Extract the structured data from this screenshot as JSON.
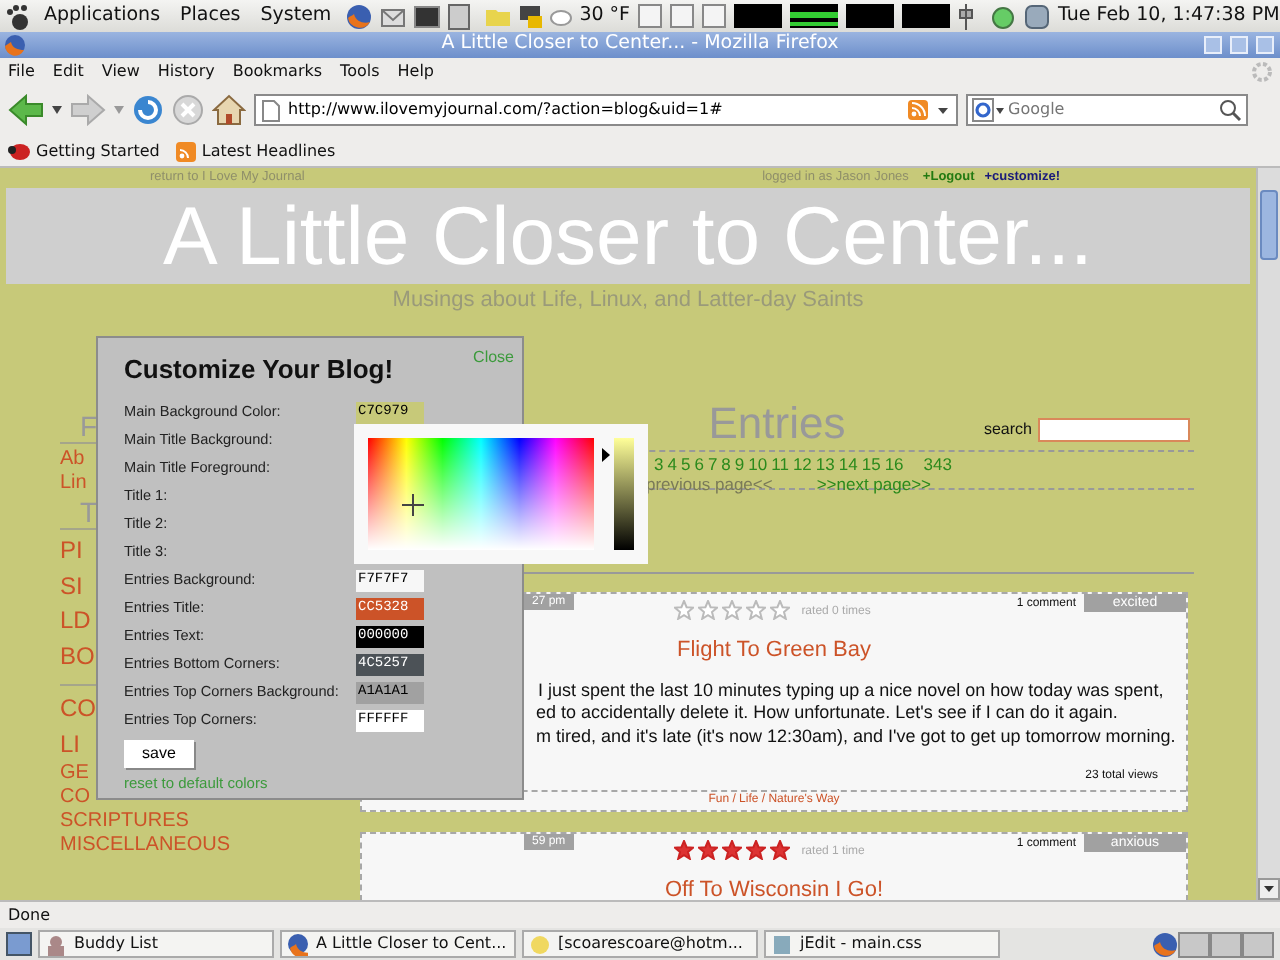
{
  "panel": {
    "menus": [
      "Applications",
      "Places",
      "System"
    ],
    "weather": "30 °F",
    "clock": "Tue Feb 10,  1:47:38 PM"
  },
  "window": {
    "title": "A Little Closer to Center... - Mozilla Firefox"
  },
  "menu_bar": [
    "File",
    "Edit",
    "View",
    "History",
    "Bookmarks",
    "Tools",
    "Help"
  ],
  "address_bar": {
    "value": "http://www.ilovemyjournal.com/?action=blog&uid=1#"
  },
  "search_bar": {
    "placeholder": "Google"
  },
  "bookmarks": [
    "Getting Started",
    "Latest Headlines"
  ],
  "page": {
    "return_link": "return to I Love My Journal",
    "logged_in": "logged in as Jason Jones",
    "logout": "+Logout",
    "customize": "+customize!",
    "blog_title": "A Little Closer to Center...",
    "subtitle": "Musings about Life, Linux, and Latter-day Saints",
    "sidebar": [
      {
        "kind": "heading",
        "text": "F"
      },
      {
        "kind": "small",
        "text": "Ab"
      },
      {
        "kind": "small",
        "text": "Lin"
      },
      {
        "kind": "heading",
        "text": "T"
      },
      {
        "kind": "large",
        "text": "PI"
      },
      {
        "kind": "large",
        "text": "SI"
      },
      {
        "kind": "large",
        "text": "LD"
      },
      {
        "kind": "large",
        "text": "BO"
      },
      {
        "kind": "divider"
      },
      {
        "kind": "large",
        "text": "CO"
      },
      {
        "kind": "large",
        "text": "LI"
      },
      {
        "kind": "medium",
        "text": "GE"
      },
      {
        "kind": "medium",
        "text": "CO"
      },
      {
        "kind": "medium",
        "text": "SCRIPTURES"
      },
      {
        "kind": "medium",
        "text": "MISCELLANEOUS"
      }
    ],
    "entries_heading": "Entries",
    "search_label": "search",
    "pager": {
      "pages": [
        "3",
        "4",
        "5",
        "6",
        "7",
        "8",
        "9",
        "10",
        "11",
        "12",
        "13",
        "14",
        "15",
        "16",
        "343"
      ],
      "previous": {
        "text": "previous page<<",
        "disabled": true
      },
      "next": {
        "text": ">>next page>>",
        "disabled": false
      }
    },
    "entries": [
      {
        "time": "27 pm",
        "comments": "1 comment",
        "mood": "excited",
        "stars": 0,
        "rating": "rated 0 times",
        "title": "Flight To Green Bay",
        "body": [
          "I just spent the last 10 minutes typing up a nice novel on how today was spent,",
          "ed to accidentally delete it.  How unfortunate.  Let's see if I can do it again.",
          "m tired, and it's late (it's now 12:30am), and I've got to get up tomorrow morning."
        ],
        "views": "23 total views",
        "tags": "Fun / Life / Nature's Way"
      },
      {
        "time": "59 pm",
        "comments": "1 comment",
        "mood": "anxious",
        "stars": 5,
        "rating": "rated 1 time",
        "title": "Off To Wisconsin I Go!"
      }
    ],
    "customize_dialog": {
      "title": "Customize Your Blog!",
      "close": "Close",
      "fields": [
        {
          "label": "Main Background Color:",
          "value": "C7C979",
          "color": "#c7c979"
        },
        {
          "label": "Main Title Background:"
        },
        {
          "label": "Main Title Foreground:"
        },
        {
          "label": "Title 1:"
        },
        {
          "label": "Title 2:"
        },
        {
          "label": "Title 3:"
        },
        {
          "label": "Entries Background:",
          "value": "F7F7F7",
          "color": "#f7f7f7"
        },
        {
          "label": "Entries Title:",
          "value": "CC5328",
          "color": "#cc5328"
        },
        {
          "label": "Entries Text:",
          "value": "000000",
          "color": "#000000"
        },
        {
          "label": "Entries Bottom Corners:",
          "value": "4C5257",
          "color": "#4c5257"
        },
        {
          "label": "Entries Top Corners Background:",
          "value": "A1A1A1",
          "color": "#a1a1a1"
        },
        {
          "label": "Entries Top Corners:",
          "value": "FFFFFF",
          "color": "#ffffff"
        }
      ],
      "save": "save",
      "reset": "reset to default colors",
      "color_picker": {
        "level": 0.85
      }
    }
  },
  "status_bar": "Done",
  "taskbar": [
    "Buddy List",
    "A Little Closer to Cent...",
    "[scoarescoare@hotm...",
    "jEdit - main.css"
  ]
}
